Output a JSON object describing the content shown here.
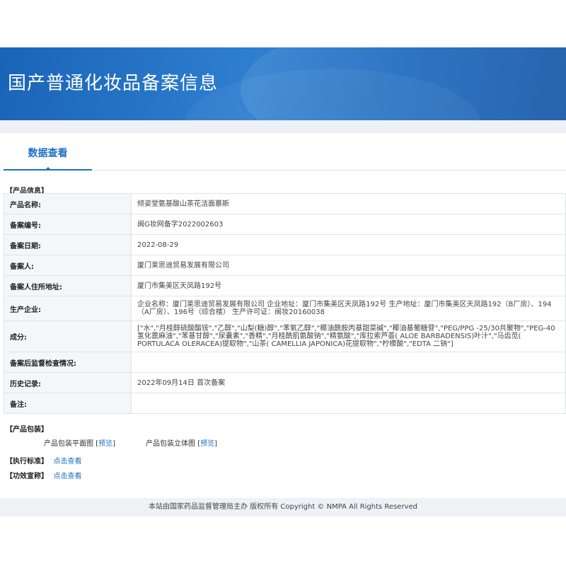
{
  "banner": {
    "title": "国产普通化妆品备案信息"
  },
  "tabs": [
    {
      "label": "数据查看"
    }
  ],
  "product_info": {
    "section_label": "【产品信息】",
    "rows": [
      {
        "key": "产品名称:",
        "value": "倾姿堂氨基酸山茶花洁面慕斯"
      },
      {
        "key": "备案编号:",
        "value": "闽G妆网备字2022002603"
      },
      {
        "key": "备案日期:",
        "value": "2022-08-29"
      },
      {
        "key": "备案人:",
        "value": "厦门莱思迪贸易发展有限公司"
      },
      {
        "key": "备案人住所地址:",
        "value": "厦门市集美区天凤路192号"
      },
      {
        "key": "生产企业:",
        "value": "企业名称：厦门莱思迪贸易发展有限公司 企业地址：厦门市集美区天凤路192号 生产地址：厦门市集美区天凤路192（B厂房）、194（A厂房）、196号（综合楼） 生产许可证：闽妆20160038"
      },
      {
        "key": "成分:",
        "value": "[\"水\",\"月桂醇硫酸酯铵\",\"乙醇\",\"山梨(糖)醇\",\"苯氧乙醇\",\"椰油酰胺丙基甜菜碱\",\"椰油基葡糖苷\",\"PEG/PPG -25/30共聚物\",\"PEG-40 氢化蓖麻油\",\"苯基甘醇\",\"尿囊素\",\"香精\",\"月桂酰肌氨酸钠\",\"精氨酸\",\"库拉索芦荟( ALOE BARBADENSIS)叶汁\",\"马齿苋( PORTULACA OLERACEA)提取物\",\"山茶( CAMELLIA JAPONICA)花提取物\",\"柠檬酸\",\"EDTA 二钠\"]"
      },
      {
        "key": "备案后监督检查情况:",
        "value": ""
      },
      {
        "key": "历史记录:",
        "value": "2022年09月14日 首次备案"
      },
      {
        "key": "备注:",
        "value": ""
      }
    ]
  },
  "packaging": {
    "section_label": "【产品包装】",
    "items": [
      {
        "label": "产品包装平面图",
        "link": "预览"
      },
      {
        "label": "产品包装立体图",
        "link": "预览"
      }
    ]
  },
  "standard": {
    "label": "【执行标准】",
    "link": "点击查看"
  },
  "efficacy": {
    "label": "【功效宣称】",
    "link": "点击查看"
  },
  "footer": {
    "text": "本站由国家药品监督管理局主办 版权所有 Copyright © NMPA All Rights Reserved"
  }
}
